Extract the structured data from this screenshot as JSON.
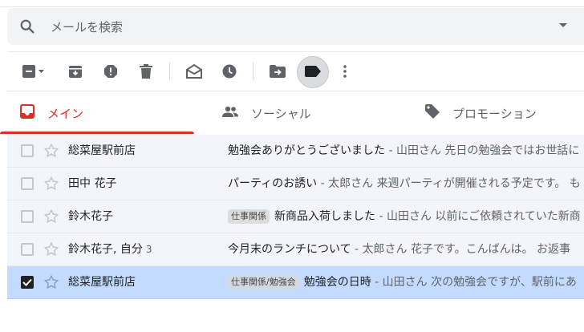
{
  "search": {
    "placeholder": "メールを検索"
  },
  "tabs": [
    {
      "label": "メイン",
      "icon": "inbox-icon",
      "active": true
    },
    {
      "label": "ソーシャル",
      "icon": "people-icon",
      "active": false
    },
    {
      "label": "プロモーション",
      "icon": "tag-icon",
      "active": false
    }
  ],
  "toolbar": {
    "icons": [
      "select-checkbox-icon",
      "archive-icon",
      "report-spam-icon",
      "delete-icon",
      "mark-read-icon",
      "snooze-icon",
      "move-to-icon",
      "label-icon",
      "more-vert-icon"
    ]
  },
  "emails": [
    {
      "sender": "総菜屋駅前店",
      "count": "",
      "badge": "",
      "subject": "勉強会ありがとうございました",
      "snippet": "山田さん 先日の勉強会ではお世話に",
      "selected": false
    },
    {
      "sender": "田中 花子",
      "count": "",
      "badge": "",
      "subject": "パーティのお誘い",
      "snippet": "太郎さん 来週パーティが開催される予定です。 も",
      "selected": false
    },
    {
      "sender": "鈴木花子",
      "count": "",
      "badge": "仕事関係",
      "subject": "新商品入荷しました",
      "snippet": "山田さん 以前にご依頼されていた新商",
      "selected": false
    },
    {
      "sender": "鈴木花子, 自分",
      "count": "3",
      "badge": "",
      "subject": "今月末のランチについて",
      "snippet": "太郎さん 花子です。こんばんは。 お返事",
      "selected": false
    },
    {
      "sender": "総菜屋駅前店",
      "count": "",
      "badge": "仕事関係/勉強会",
      "subject": "勉強会の日時",
      "snippet": "山田さん 次の勉強会ですが、駅前にあ",
      "selected": true
    }
  ],
  "colors": {
    "accent": "#d93025",
    "selected_row": "#c2dbff",
    "read_row": "#f2f6fc"
  }
}
